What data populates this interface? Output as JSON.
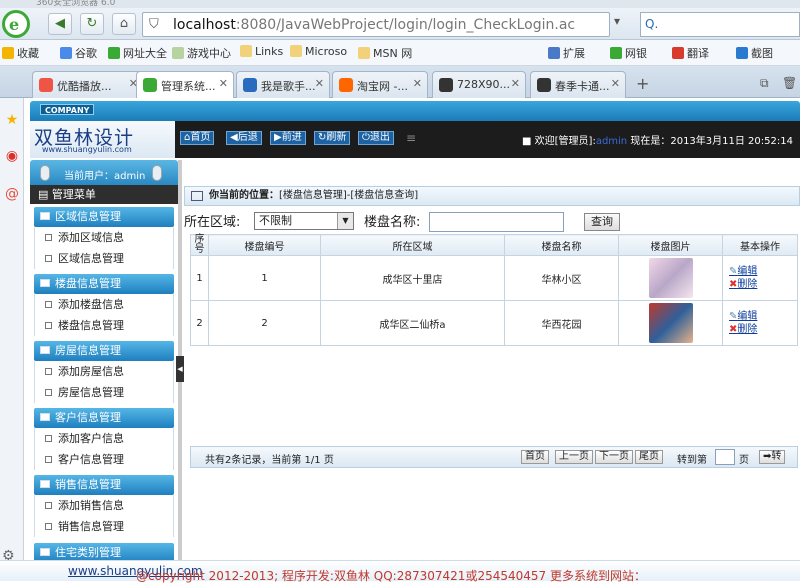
{
  "browser": {
    "title_fragment": "360安全浏览器 6.0",
    "url_host": "localhost",
    "url_rest": ":8080/JavaWebProject/login/login_CheckLogin.ac",
    "bookmarks": [
      "收藏",
      "谷歌",
      "网址大全",
      "游戏中心",
      "Links",
      "Microso",
      "MSN 网"
    ],
    "toolbar_right": [
      "扩展",
      "网银",
      "翻译",
      "截图"
    ],
    "tabs": [
      "优酷播放...",
      "管理系统...",
      "我是歌手...",
      "淘宝网 -...",
      "728X90...",
      "春季卡通..."
    ]
  },
  "header": {
    "company": "COMPANY",
    "brand": "双鱼林设计",
    "brand_url": "www.shuangyulin.com",
    "buttons": [
      "首页",
      "后退",
      "前进",
      "刷新",
      "退出"
    ],
    "welcome_prefix": "欢迎[管理员]:",
    "welcome_user": "admin",
    "welcome_suffix": "现在是：2013年3月11日 20:52:14"
  },
  "sidebar": {
    "current_user": "当前用户：admin",
    "menu_title": "管理菜单",
    "groups": [
      {
        "title": "区域信息管理",
        "items": [
          "添加区域信息",
          "区域信息管理"
        ]
      },
      {
        "title": "楼盘信息管理",
        "items": [
          "添加楼盘信息",
          "楼盘信息管理"
        ]
      },
      {
        "title": "房屋信息管理",
        "items": [
          "添加房屋信息",
          "房屋信息管理"
        ]
      },
      {
        "title": "客户信息管理",
        "items": [
          "添加客户信息",
          "客户信息管理"
        ]
      },
      {
        "title": "销售信息管理",
        "items": [
          "添加销售信息",
          "销售信息管理"
        ]
      },
      {
        "title": "住宅类别管理",
        "items": []
      }
    ]
  },
  "content": {
    "crumb_label": "你当前的位置：",
    "crumb_path": "[楼盘信息管理]-[楼盘信息查询]",
    "filter_area_label": "所在区域:",
    "filter_area_value": "不限制",
    "filter_name_label": "楼盘名称:",
    "query_label": "查询",
    "columns": [
      "序号",
      "楼盘编号",
      "所在区域",
      "楼盘名称",
      "楼盘图片",
      "基本操作"
    ],
    "rows": [
      {
        "idx": "1",
        "code": "1",
        "area": "成华区十里店",
        "name": "华林小区",
        "edit": "编辑",
        "del": "删除"
      },
      {
        "idx": "2",
        "code": "2",
        "area": "成华区二仙桥a",
        "name": "华西花园",
        "edit": "编辑",
        "del": "删除"
      }
    ],
    "pager_info": "共有2条记录，当前第 1/1 页",
    "pager_buttons": [
      "首页",
      "上一页",
      "下一页",
      "尾页"
    ],
    "goto_label": "转到第",
    "goto_unit": "页",
    "goto_btn": "转"
  },
  "footer": {
    "text": "@copyright 2012-2013; 程序开发:双鱼林  QQ:287307421或254540457  更多系统到网站：",
    "link": "www.shuangyulin.com"
  }
}
